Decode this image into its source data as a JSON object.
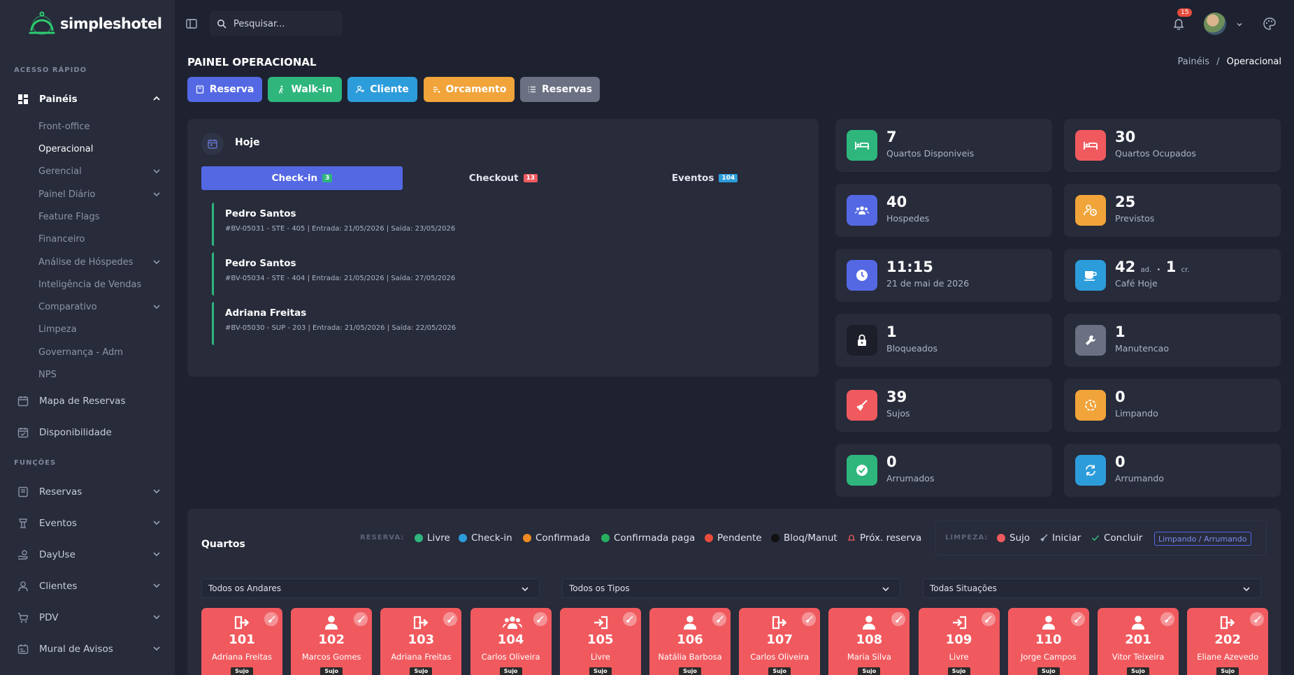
{
  "app": {
    "name": "simpleshotel"
  },
  "colors": {
    "primary": "#5468e4",
    "success": "#2eb67d",
    "info": "#2d9cdb",
    "warning": "#f0a43a",
    "danger": "#f05a5e",
    "secondary": "#6b7082"
  },
  "sidebar": {
    "quick_access_label": "ACESSO RÁPIDO",
    "paineis": {
      "label": "Painéis",
      "items": [
        {
          "label": "Front-office"
        },
        {
          "label": "Operacional"
        },
        {
          "label": "Gerencial"
        },
        {
          "label": "Painel Diário"
        },
        {
          "label": "Feature Flags"
        },
        {
          "label": "Financeiro"
        },
        {
          "label": "Análise de Hóspedes"
        },
        {
          "label": "Inteligência de Vendas"
        },
        {
          "label": "Comparativo"
        },
        {
          "label": "Limpeza"
        },
        {
          "label": "Governança - Adm"
        },
        {
          "label": "NPS"
        }
      ]
    },
    "mapa_reservas": "Mapa de Reservas",
    "disponibilidade": "Disponibilidade",
    "functions_label": "FUNÇÕES",
    "functions": [
      {
        "label": "Reservas"
      },
      {
        "label": "Eventos"
      },
      {
        "label": "DayUse"
      },
      {
        "label": "Clientes"
      },
      {
        "label": "PDV"
      },
      {
        "label": "Mural de Avisos"
      }
    ]
  },
  "topbar": {
    "search_placeholder": "Pesquisar...",
    "notifications_count": "15"
  },
  "page": {
    "title": "PAINEL OPERACIONAL",
    "breadcrumb": {
      "parent": "Painéis",
      "sep": "/",
      "current": "Operacional"
    }
  },
  "quick_buttons": [
    {
      "label": "Reserva"
    },
    {
      "label": "Walk-in"
    },
    {
      "label": "Cliente"
    },
    {
      "label": "Orcamento"
    },
    {
      "label": "Reservas"
    }
  ],
  "today": {
    "title": "Hoje",
    "tabs": [
      {
        "label": "Check-in",
        "count": "3"
      },
      {
        "label": "Checkout",
        "count": "13"
      },
      {
        "label": "Eventos",
        "count": "104"
      }
    ],
    "bookings": [
      {
        "name": "Pedro Santos",
        "details": "#BV-05031 - STE - 405 | Entrada: 21/05/2026 | Saída: 23/05/2026"
      },
      {
        "name": "Pedro Santos",
        "details": "#BV-05034 - STE - 404 | Entrada: 21/05/2026 | Saída: 27/05/2026"
      },
      {
        "name": "Adriana Freitas",
        "details": "#BV-05030 - SUP - 203 | Entrada: 21/05/2026 | Saída: 22/05/2026"
      }
    ]
  },
  "stats": [
    {
      "value": "7",
      "label": "Quartos Disponiveis",
      "icon": "bed-icon",
      "color": "#2eb67d"
    },
    {
      "value": "30",
      "label": "Quartos Ocupados",
      "icon": "bed-icon",
      "color": "#f05a5e"
    },
    {
      "value": "40",
      "label": "Hospedes",
      "icon": "users-icon",
      "color": "#5468e4"
    },
    {
      "value": "25",
      "label": "Previstos",
      "icon": "user-clock-icon",
      "color": "#f0a43a"
    },
    {
      "value": "11:15",
      "label": "21 de mai de 2026",
      "icon": "clock-icon",
      "color": "#5468e4"
    },
    {
      "value_adults": "42",
      "unit_adults": "ad.",
      "dot": "•",
      "value_children": "1",
      "unit_children": "cr.",
      "label": "Café Hoje",
      "icon": "coffee-icon",
      "color": "#2d9cdb"
    },
    {
      "value": "1",
      "label": "Bloqueados",
      "icon": "lock-icon",
      "color": "#1c1f2a"
    },
    {
      "value": "1",
      "label": "Manutencao",
      "icon": "wrench-icon",
      "color": "#6b7082"
    },
    {
      "value": "39",
      "label": "Sujos",
      "icon": "broom-icon",
      "color": "#f05a5e"
    },
    {
      "value": "0",
      "label": "Limpando",
      "icon": "spinner-icon",
      "color": "#f0a43a"
    },
    {
      "value": "0",
      "label": "Arrumados",
      "icon": "check-circle-icon",
      "color": "#2eb67d"
    },
    {
      "value": "0",
      "label": "Arrumando",
      "icon": "sync-icon",
      "color": "#2d9cdb"
    }
  ],
  "rooms": {
    "title": "Quartos",
    "legend_reserva_label": "RESERVA:",
    "legend_reserva": [
      {
        "label": "Livre",
        "color": "#2eb67d"
      },
      {
        "label": "Check-in",
        "color": "#2d9cdb"
      },
      {
        "label": "Confirmada",
        "color": "#f08a24"
      },
      {
        "label": "Confirmada paga",
        "color": "#27ae60"
      },
      {
        "label": "Pendente",
        "color": "#e74c3c"
      },
      {
        "label": "Bloq/Manut",
        "color": "#111111"
      },
      {
        "label": "Próx. reserva",
        "color": "#f05a5e"
      }
    ],
    "legend_limpeza_label": "LIMPEZA:",
    "legend_limpeza": [
      {
        "label": "Sujo"
      },
      {
        "label": "Iniciar"
      },
      {
        "label": "Concluir"
      }
    ],
    "legend_limpando": "Limpando / Arrumando",
    "filters": [
      {
        "value": "Todos os Andares"
      },
      {
        "value": "Todos os Tipos"
      },
      {
        "value": "Todas Situações"
      }
    ],
    "list": [
      {
        "number": "101",
        "guest": "Adriana Freitas",
        "status": "Sujo",
        "icon": "checkout-icon"
      },
      {
        "number": "102",
        "guest": "Marcos Gomes",
        "status": "Sujo",
        "icon": "user-icon"
      },
      {
        "number": "103",
        "guest": "Adriana Freitas",
        "status": "Sujo",
        "icon": "checkout-icon"
      },
      {
        "number": "104",
        "guest": "Carlos Oliveira",
        "status": "Sujo",
        "icon": "users-icon"
      },
      {
        "number": "105",
        "guest": "Livre",
        "status": "Sujo",
        "icon": "checkin-icon"
      },
      {
        "number": "106",
        "guest": "Natália Barbosa",
        "status": "Sujo",
        "icon": "user-icon"
      },
      {
        "number": "107",
        "guest": "Carlos Oliveira",
        "status": "Sujo",
        "icon": "checkout-icon"
      },
      {
        "number": "108",
        "guest": "Maria Silva",
        "status": "Sujo",
        "icon": "user-icon"
      },
      {
        "number": "109",
        "guest": "Livre",
        "status": "Sujo",
        "icon": "checkin-icon"
      },
      {
        "number": "110",
        "guest": "Jorge Campos",
        "status": "Sujo",
        "icon": "user-icon"
      },
      {
        "number": "201",
        "guest": "Vitor Teixeira",
        "status": "Sujo",
        "icon": "user-icon"
      },
      {
        "number": "202",
        "guest": "Eliane Azevedo",
        "status": "Sujo",
        "icon": "checkout-icon"
      }
    ]
  }
}
